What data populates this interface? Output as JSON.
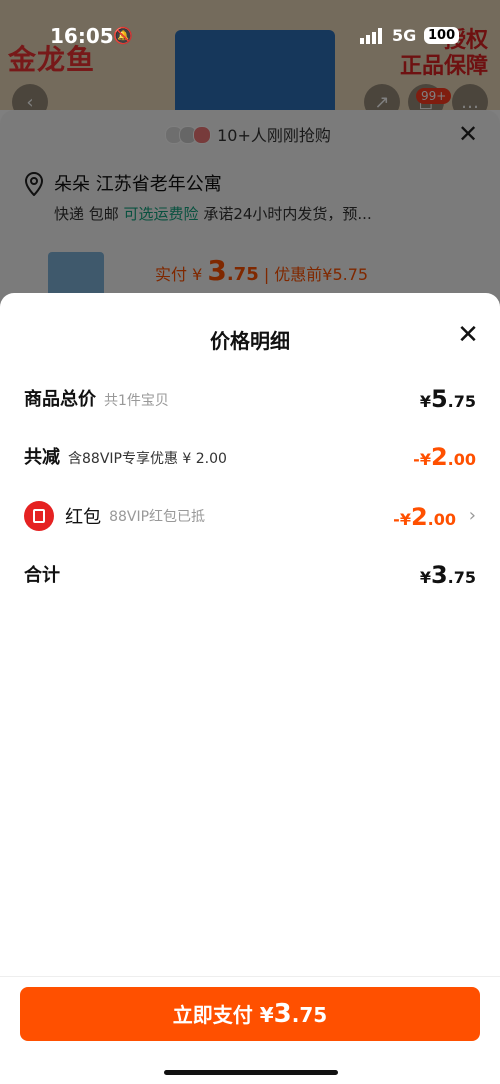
{
  "status_bar": {
    "time": "16:05",
    "network": "5G",
    "battery": "100"
  },
  "background": {
    "brand": "金龙鱼",
    "badge_line1": "授权",
    "badge_line2": "正品保障",
    "cart_badge": "99+",
    "buyers_text": "10+人刚刚抢购",
    "address": "朵朵 江苏省老年公寓",
    "shipping_prefix": "快递 包邮 ",
    "shipping_insurance": "可选运费险",
    "shipping_suffix": " 承诺24小时内发货，预...",
    "paid_label": "实付 ¥ ",
    "paid_int": "3",
    "paid_dec": ".75",
    "before_discount": " | 优惠前¥5.75"
  },
  "sheet": {
    "title": "价格明细",
    "rows": [
      {
        "label": "商品总价",
        "sub": "共1件宝贝",
        "currency": "¥",
        "int": "5",
        "dec": ".75"
      },
      {
        "label": "共减",
        "sub": "含88VIP专享优惠 ¥ 2.00",
        "currency": "-¥",
        "int": "2",
        "dec": ".00"
      },
      {
        "label": "红包",
        "sub": "88VIP红包已抵",
        "currency": "-¥",
        "int": "2",
        "dec": ".00"
      },
      {
        "label": "合计",
        "sub": "",
        "currency": "¥",
        "int": "3",
        "dec": ".75"
      }
    ],
    "pay_button": {
      "label": "立即支付",
      "currency": "¥",
      "int": "3",
      "dec": ".75"
    }
  }
}
